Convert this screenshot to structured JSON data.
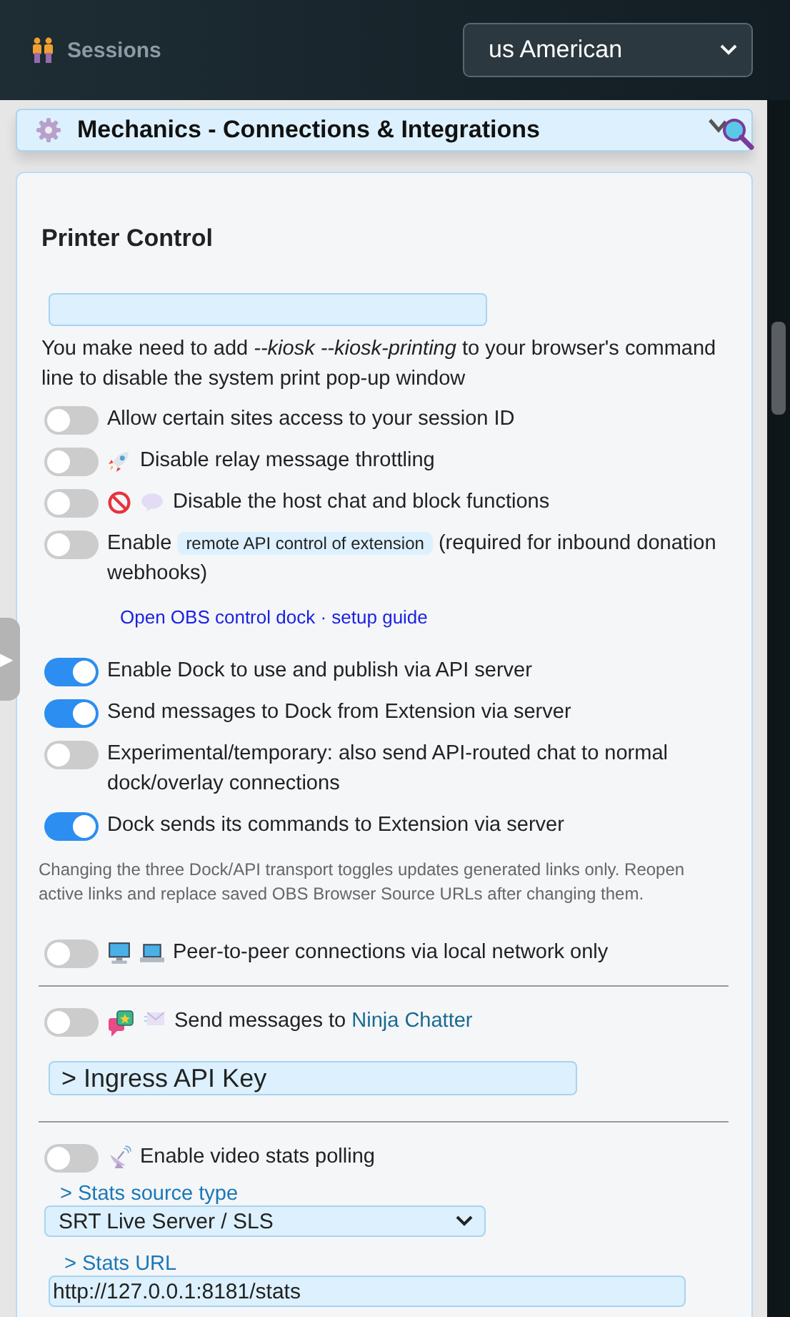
{
  "header": {
    "title": "Sessions",
    "language": "us American"
  },
  "section": {
    "title": "Mechanics - Connections & Integrations"
  },
  "side_tab": {
    "glyph": "▶"
  },
  "card": {
    "heading": "Printer Control",
    "note": "You make need to add *--kiosk --kiosk-printing* to your browser's command line to disable the system print pop-up window",
    "rows": [
      {
        "kind": "toggle",
        "on": false,
        "label": "Allow certain sites access to your session ID"
      },
      {
        "kind": "toggle",
        "on": false,
        "label": "Disable relay message throttling"
      },
      {
        "kind": "toggle",
        "on": false,
        "label": "Disable the host chat and block functions"
      },
      {
        "kind": "badge-toggle",
        "on": false,
        "label": "Enable",
        "badge": "remote API control of extension",
        "after": "(required for inbound donation webhooks)"
      },
      {
        "kind": "links",
        "links": [
          "Open OBS control dock",
          "setup guide"
        ],
        "separator": "·"
      },
      {
        "kind": "toggle",
        "on": true,
        "label": "Enable Dock to use and publish via API server"
      },
      {
        "kind": "toggle",
        "on": true,
        "label": "Send messages to Dock from Extension via server"
      },
      {
        "kind": "toggle",
        "on": false,
        "label": "Experimental/temporary: also send API-routed chat to normal dock/overlay connections"
      },
      {
        "kind": "toggle",
        "on": true,
        "label": "Dock sends its commands to Extension via server"
      },
      {
        "kind": "note",
        "text": "Changing the three Dock/API transport toggles updates generated links only. Reopen active links and replace saved OBS Browser Source URLs after changing them."
      },
      {
        "kind": "toggle",
        "on": false,
        "label": "Peer-to-peer connections via local network only"
      },
      {
        "kind": "divider"
      },
      {
        "kind": "link-toggle",
        "on": false,
        "label": "Send messages to",
        "link": "Ninja Chatter"
      },
      {
        "kind": "field",
        "placeholder": "> Ingress API Key"
      },
      {
        "kind": "divider"
      },
      {
        "kind": "toggle",
        "on": false,
        "label": "Enable video stats polling"
      },
      {
        "kind": "select",
        "label": "> Stats source type",
        "value": "SRT Live Server / SLS"
      },
      {
        "kind": "labeled-field",
        "label": "> Stats URL",
        "value": "http://127.0.0.1:8181/stats"
      }
    ]
  }
}
